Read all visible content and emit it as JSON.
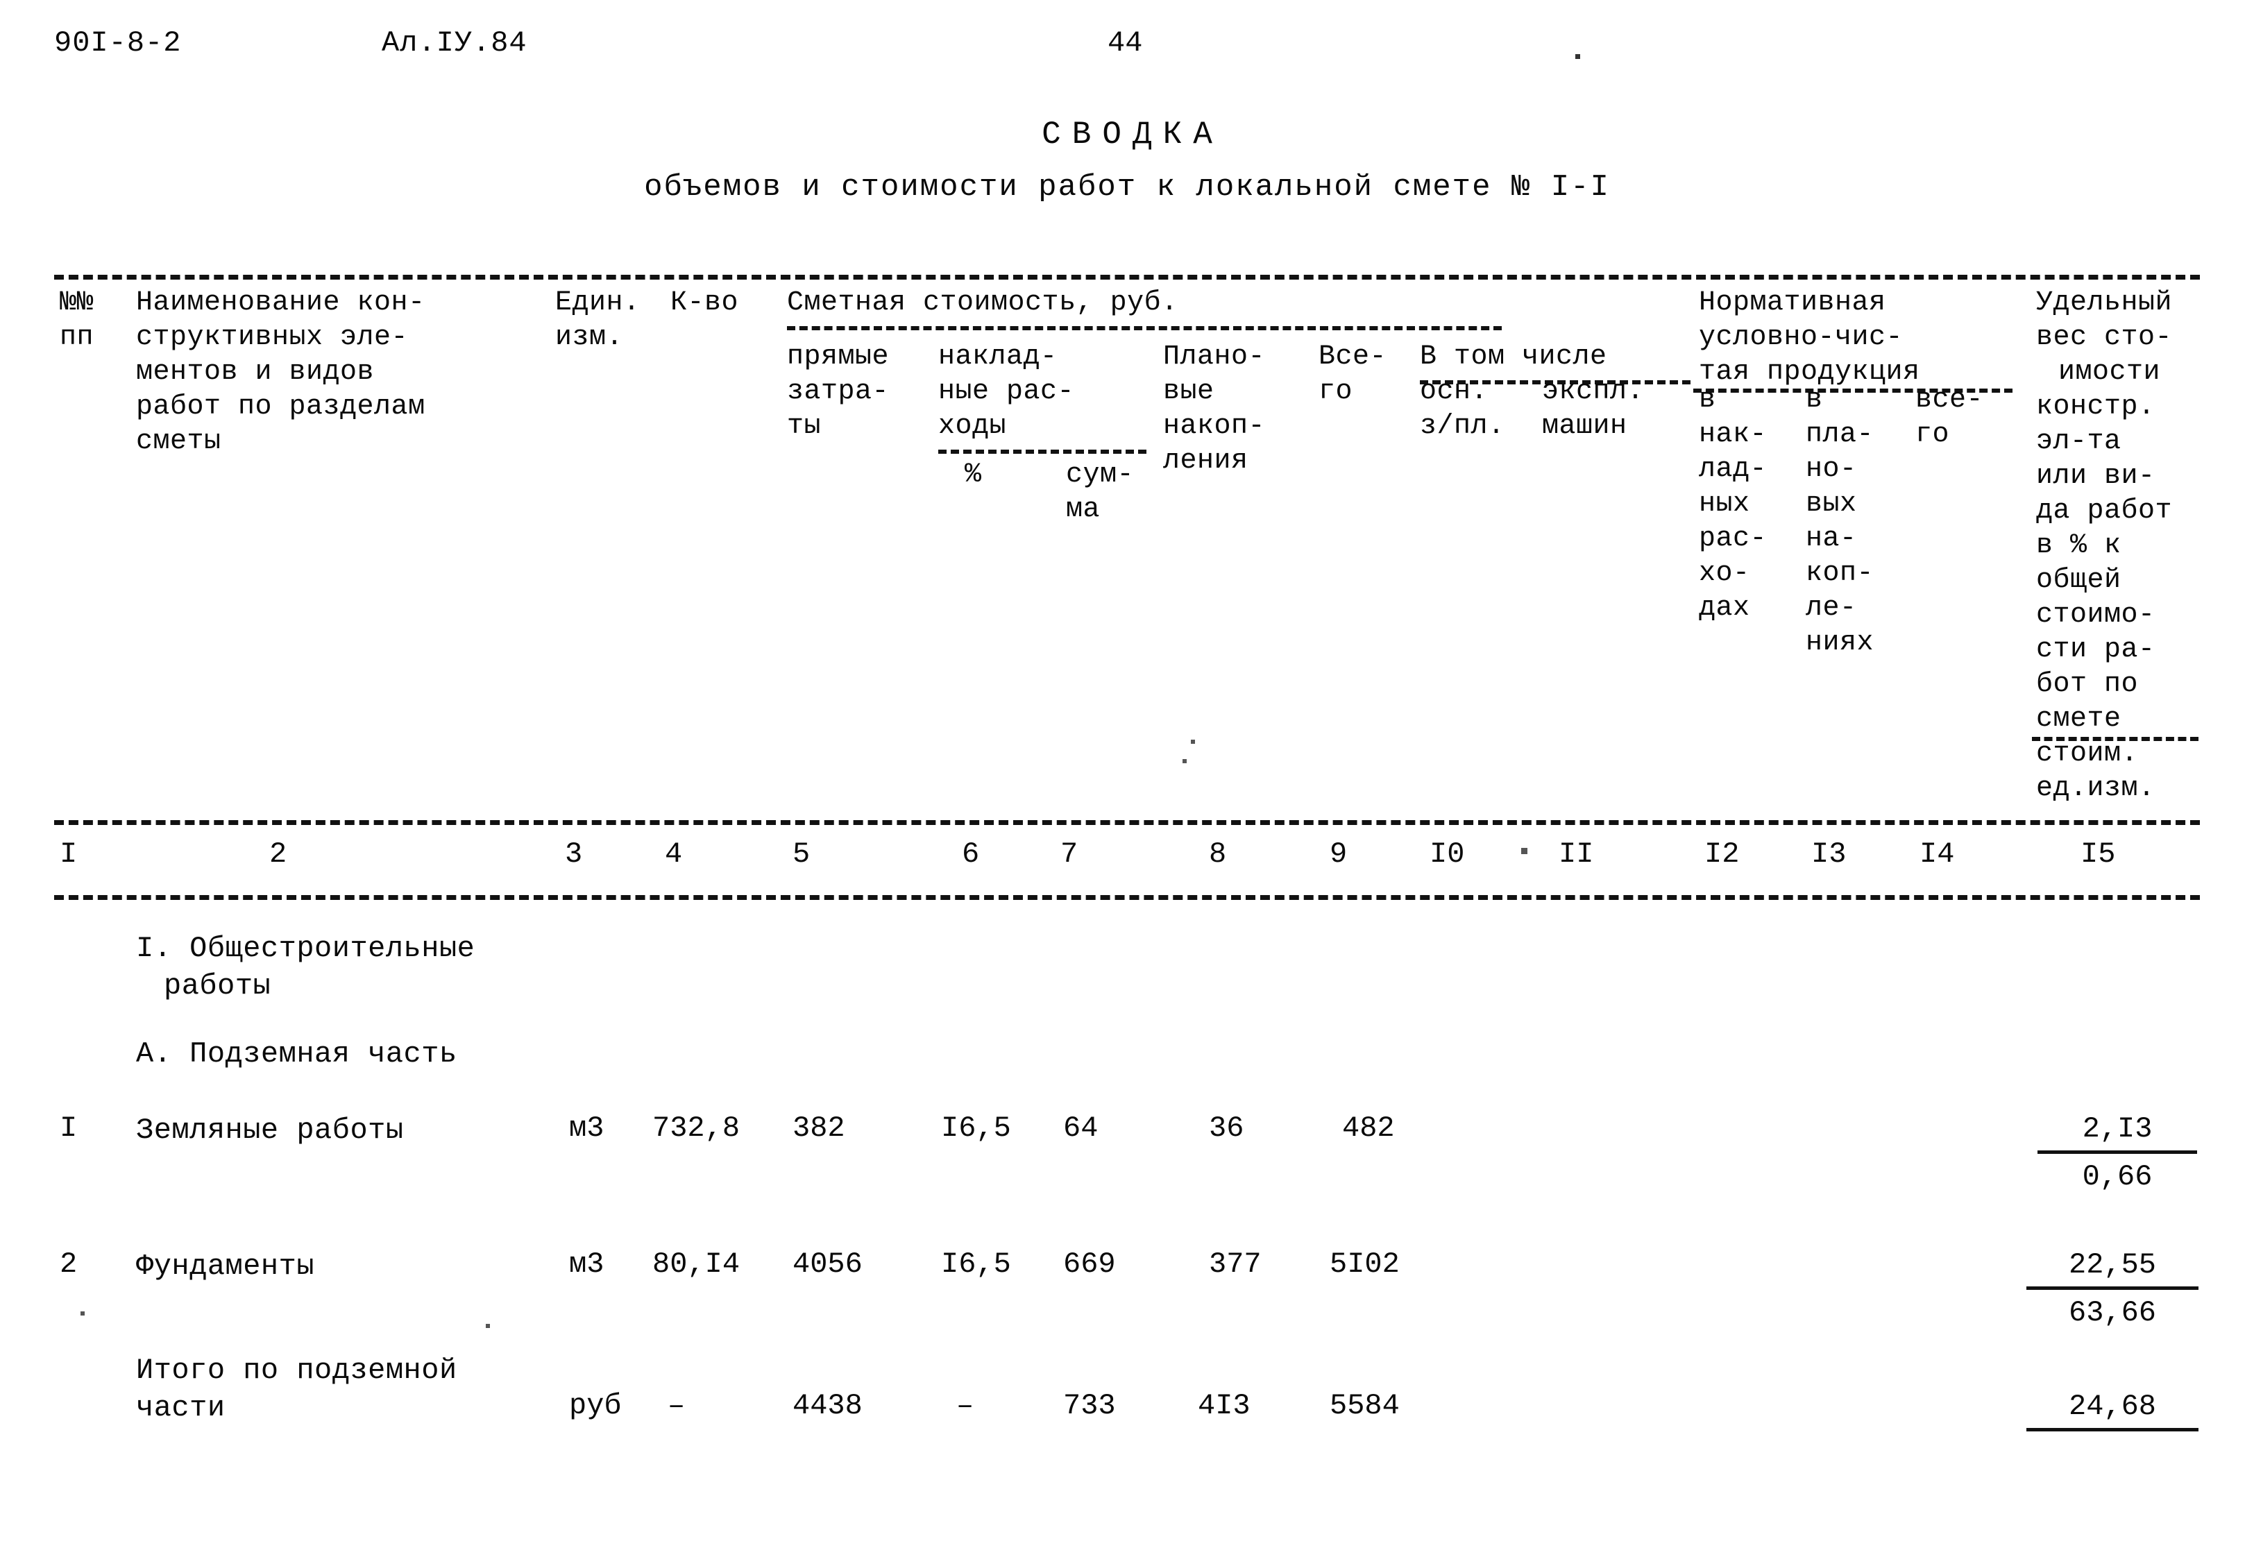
{
  "document": {
    "series_code": "90I-8-2",
    "album_code": "Ал.IУ.84",
    "page_number": "44",
    "title": "СВОДКА",
    "subtitle": "объемов и стоимости работ к локальной смете № I-I"
  },
  "table": {
    "headers": {
      "no_pp_line1": "№№",
      "no_pp_line2": "пп",
      "name_line1": "Наименование кон-",
      "name_line2": "структивных эле-",
      "name_line3": "ментов и видов",
      "name_line4": "работ по разделам",
      "name_line5": "сметы",
      "unit_line1": "Един.",
      "unit_line2": "изм.",
      "qty": "К-во",
      "cost_group": "Сметная стоимость, руб.",
      "direct_line1": "прямые",
      "direct_line2": "затра-",
      "direct_line3": "ты",
      "overhead_line1": "наклад-",
      "overhead_line2": "ные рас-",
      "overhead_line3": "ходы",
      "overhead_pct": "%",
      "overhead_sum_line1": "сум-",
      "overhead_sum_line2": "ма",
      "profit_line1": "Плано-",
      "profit_line2": "вые",
      "profit_line3": "накоп-",
      "profit_line4": "ления",
      "total_line1": "Все-",
      "total_line2": "го",
      "incl_group": "В том числе",
      "incl_wages_line1": "осн.",
      "incl_wages_line2": "з/пл.",
      "incl_mach_line1": "экспл.",
      "incl_mach_line2": "машин",
      "ncp_group_line1": "Нормативная",
      "ncp_group_line2": "условно-чис-",
      "ncp_group_line3": "тая продукция",
      "ncp_ovh_line1": "в",
      "ncp_ovh_line2": "нак-",
      "ncp_ovh_line3": "лад-",
      "ncp_ovh_line4": "ных",
      "ncp_ovh_line5": "рас-",
      "ncp_ovh_line6": "хо-",
      "ncp_ovh_line7": "дах",
      "ncp_prof_line1": "в",
      "ncp_prof_line2": "пла-",
      "ncp_prof_line3": "но-",
      "ncp_prof_line4": "вых",
      "ncp_prof_line5": "на-",
      "ncp_prof_line6": "коп-",
      "ncp_prof_line7": "ле-",
      "ncp_prof_line8": "ниях",
      "ncp_tot_line1": "все-",
      "ncp_tot_line2": "го",
      "share_line1": "Удельный",
      "share_line2": "вес сто-",
      "share_line3": "имости",
      "share_line4": "констр.",
      "share_line5": "эл-та",
      "share_line6": "или ви-",
      "share_line7": "да работ",
      "share_line8": "в % к",
      "share_line9": "общей",
      "share_line10": "стоимо-",
      "share_line11": "сти ра-",
      "share_line12": "бот по",
      "share_line13": "смете",
      "share_line14": "стоим.",
      "share_line15": "ед.изм."
    },
    "column_numbers": [
      "I",
      "2",
      "3",
      "4",
      "5",
      "6",
      "7",
      "8",
      "9",
      "I0",
      "II",
      "I2",
      "I3",
      "I4",
      "I5"
    ],
    "section_heading_1_line1": "I. Общестроительные",
    "section_heading_1_line2": "работы",
    "section_heading_2": "А. Подземная часть",
    "rows": [
      {
        "no": "I",
        "name": "Земляные работы",
        "unit": "м3",
        "qty": "732,8",
        "direct": "382",
        "overhead_pct": "I6,5",
        "overhead_sum": "64",
        "profit": "36",
        "total": "482",
        "wages": "",
        "machines": "",
        "ncp_overhead": "",
        "ncp_profit": "",
        "ncp_total": "",
        "share_top": "2,I3",
        "share_bottom": "0,66"
      },
      {
        "no": "2",
        "name": "Фундаменты",
        "unit": "м3",
        "qty": "80,I4",
        "direct": "4056",
        "overhead_pct": "I6,5",
        "overhead_sum": "669",
        "profit": "377",
        "total": "5I02",
        "wages": "",
        "machines": "",
        "ncp_overhead": "",
        "ncp_profit": "",
        "ncp_total": "",
        "share_top": "22,55",
        "share_bottom": "63,66"
      },
      {
        "no": "",
        "name_line1": "Итого по подземной",
        "name_line2": "части",
        "unit": "руб",
        "qty": "–",
        "direct": "4438",
        "overhead_pct": "–",
        "overhead_sum": "733",
        "profit": "4I3",
        "total": "5584",
        "wages": "",
        "machines": "",
        "ncp_overhead": "",
        "ncp_profit": "",
        "ncp_total": "",
        "share_top": "24,68",
        "share_bottom": ""
      }
    ]
  }
}
